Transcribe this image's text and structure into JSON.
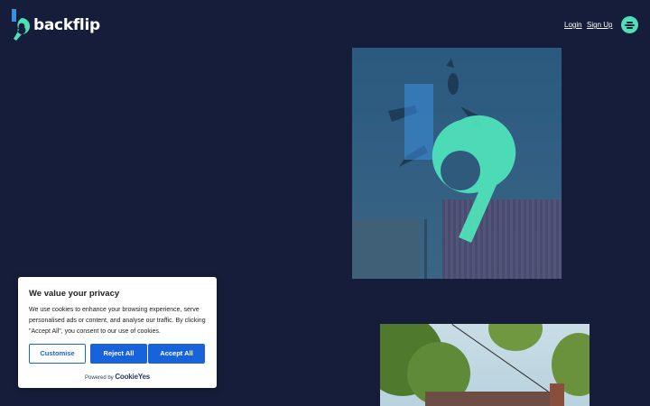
{
  "brand": {
    "name": "backflip",
    "accent_color": "#4fe0b8",
    "secondary_color": "#3a8fe0",
    "background_color": "#151d3a"
  },
  "nav": {
    "login_label": "Login",
    "signup_label": "Sign Up",
    "menu_icon": "hamburger-menu-icon"
  },
  "cookie_banner": {
    "title": "We value your privacy",
    "body": "We use cookies to enhance your browsing experience, serve personalised ads or content, and analyse our traffic. By clicking \"Accept All\", you consent to our use of cookies.",
    "customise_label": "Customise",
    "reject_label": "Reject All",
    "accept_label": "Accept All",
    "powered_by": "Powered by",
    "powered_brand": "CookieYes",
    "button_color": "#1863dc"
  }
}
